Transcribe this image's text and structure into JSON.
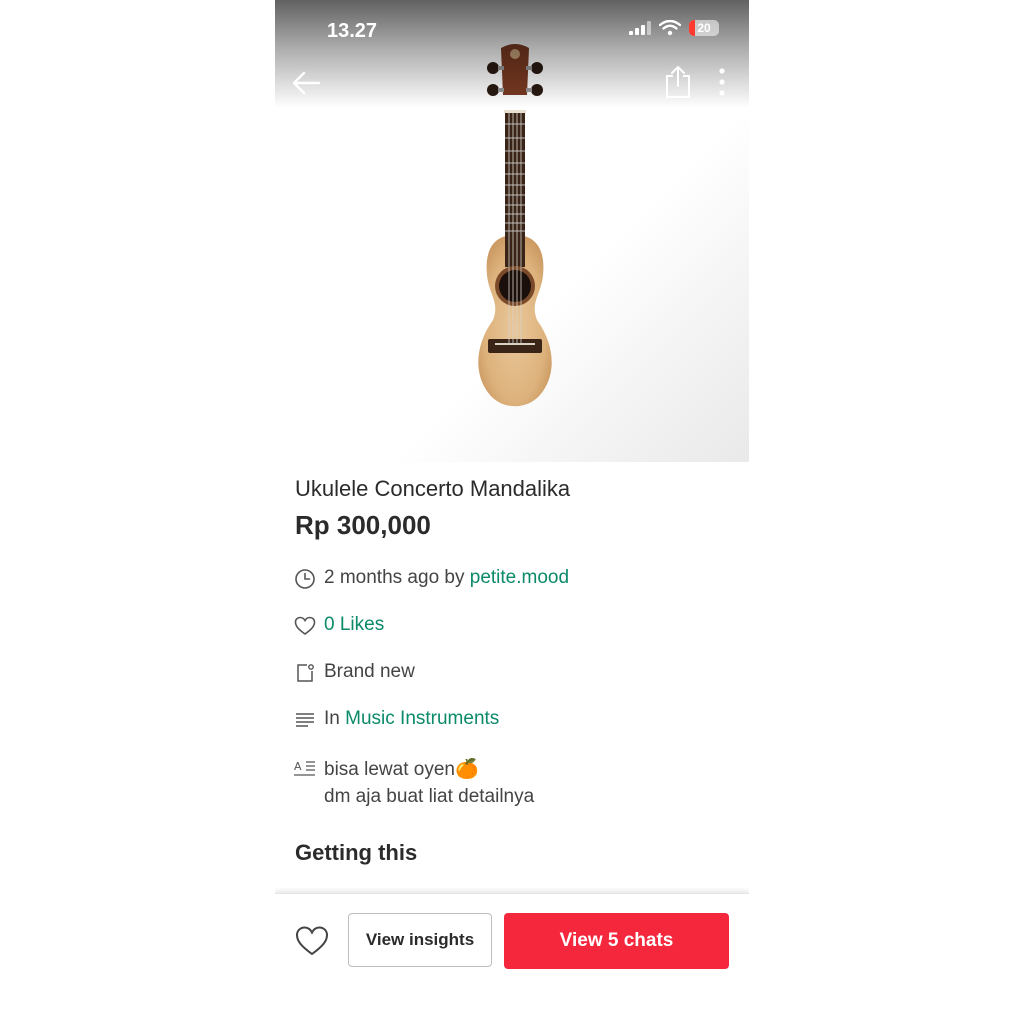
{
  "status_bar": {
    "time": "13.27",
    "battery": "20"
  },
  "product": {
    "title": "Ukulele Concerto Mandalika",
    "price": "Rp 300,000"
  },
  "meta": {
    "posted": "2 months ago by",
    "seller": "petite.mood",
    "likes": "0 Likes",
    "condition": "Brand new",
    "category_prefix": "In",
    "category": "Music Instruments",
    "description_line1": "bisa lewat oyen🍊",
    "description_line2": "dm aja buat liat detailnya"
  },
  "sections": {
    "getting_this": "Getting this"
  },
  "actions": {
    "view_insights": "View insights",
    "view_chats": "View 5 chats"
  },
  "icons": [
    "back-arrow-icon",
    "share-icon",
    "more-vertical-icon",
    "clock-icon",
    "heart-icon",
    "condition-tag-icon",
    "category-list-icon",
    "description-icon",
    "heart-outline-icon"
  ],
  "colors": {
    "accent_green": "#0b8a6a",
    "primary_red": "#f5273c"
  }
}
